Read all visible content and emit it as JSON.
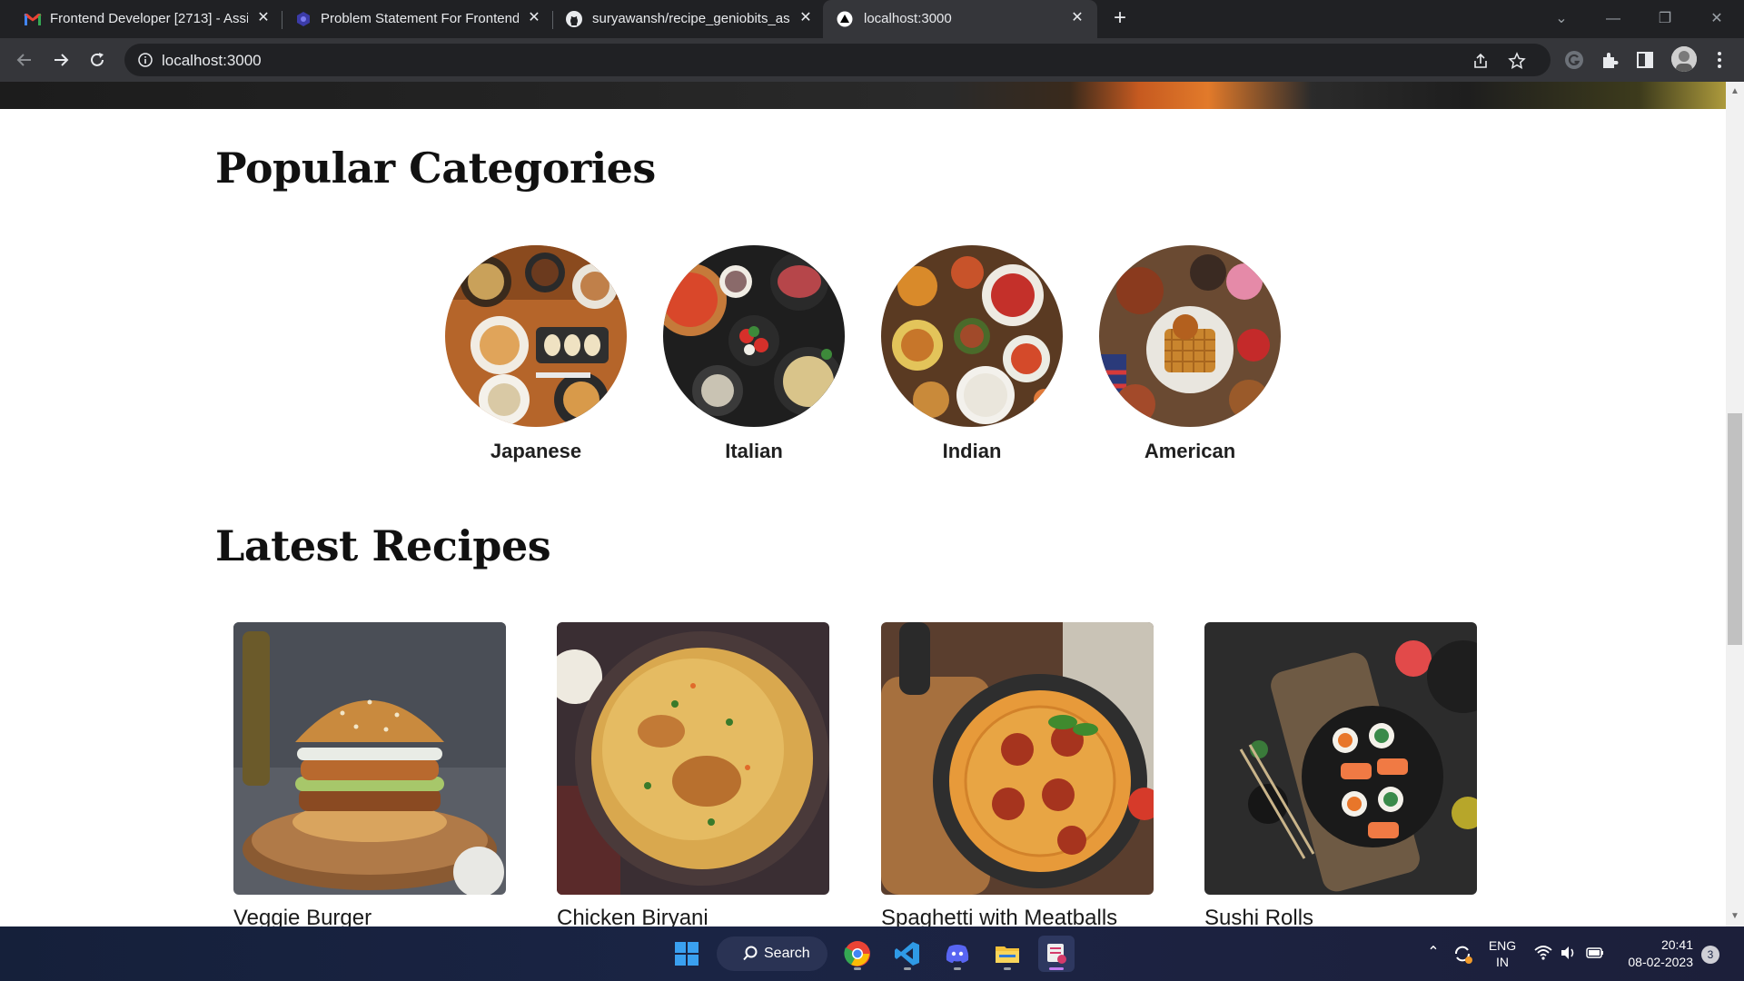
{
  "browser": {
    "tabs": [
      {
        "title": "Frontend Developer [2713] - Assi",
        "icon": "gmail-icon"
      },
      {
        "title": "Problem Statement For Frontend",
        "icon": "app-icon"
      },
      {
        "title": "suryawansh/recipe_geniobits_ass",
        "icon": "github-icon"
      },
      {
        "title": "localhost:3000",
        "icon": "nextjs-icon"
      }
    ],
    "url": "localhost:3000"
  },
  "page": {
    "categories_title": "Popular Categories",
    "categories": [
      {
        "label": "Japanese"
      },
      {
        "label": "Italian"
      },
      {
        "label": "Indian"
      },
      {
        "label": "American"
      }
    ],
    "recipes_title": "Latest Recipes",
    "recipes": [
      {
        "name": "Veggie Burger"
      },
      {
        "name": "Chicken Biryani"
      },
      {
        "name": "Spaghetti with Meatballs"
      },
      {
        "name": "Sushi Rolls"
      }
    ]
  },
  "taskbar": {
    "search_label": "Search",
    "lang_top": "ENG",
    "lang_bottom": "IN",
    "time": "20:41",
    "date": "08-02-2023",
    "notification_count": "3"
  },
  "colors": {
    "tab_bar": "#202124",
    "toolbar": "#35363a",
    "heading": "#111111",
    "taskbar": "#1a2444"
  }
}
